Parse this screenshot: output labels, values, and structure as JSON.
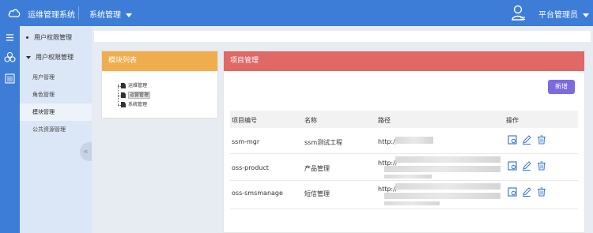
{
  "header": {
    "app_title": "运维管理系统",
    "system_menu": "系统管理",
    "user_name": "平台管理员"
  },
  "sidebar": {
    "group1": "用户权限管理",
    "group2": "用户权限管理",
    "items": [
      "用户管理",
      "角色管理",
      "模块管理",
      "公共资源管理"
    ],
    "collapse": "«"
  },
  "module_panel": {
    "title": "模块列表",
    "tree": [
      "运维管理",
      "运营管理",
      "系统管理"
    ]
  },
  "project_panel": {
    "title": "项目管理",
    "add_button": "新增",
    "columns": [
      "项目编号",
      "名称",
      "路径",
      "操作"
    ],
    "rows": [
      {
        "id": "ssm-mgr",
        "name": "ssm测试工程",
        "path": "http://"
      },
      {
        "id": "oss-product",
        "name": "产品管理",
        "path": "http://"
      },
      {
        "id": "oss-smsmanage",
        "name": "短信管理",
        "path": "http://"
      }
    ]
  },
  "colors": {
    "topbar": "#3d7dd8",
    "module_header": "#f0ad4e",
    "project_header": "#e06865",
    "add_button": "#7b6be0",
    "action_icon": "#3d7dd8"
  }
}
